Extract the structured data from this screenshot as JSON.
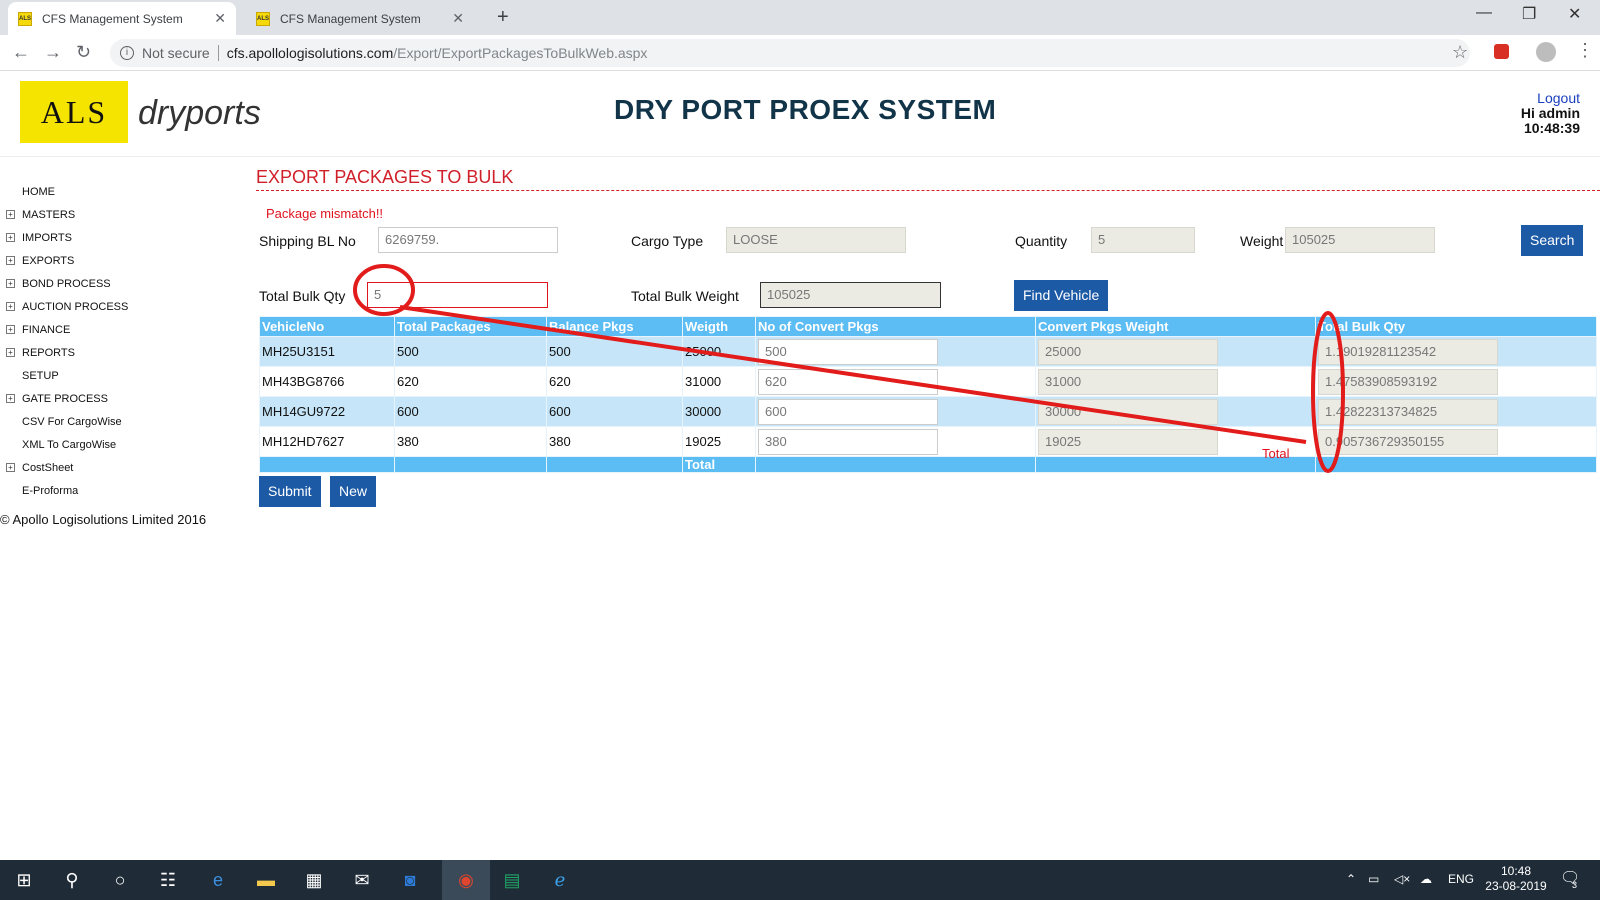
{
  "browser": {
    "tabs": [
      {
        "title": "CFS Management System",
        "favicon": "ALS"
      },
      {
        "title": "CFS Management System",
        "favicon": "ALS"
      }
    ],
    "security": "Not secure",
    "url_host": "cfs.apollologisolutions.com",
    "url_path": "/Export/ExportPackagesToBulkWeb.aspx"
  },
  "header": {
    "logo_letters": "ALS",
    "logo_text": "dryports",
    "site_title": "DRY PORT PROEX SYSTEM",
    "logout": "Logout",
    "greeting": "Hi admin",
    "time": "10:48:39"
  },
  "sidebar": {
    "items": [
      {
        "label": "HOME",
        "expandable": false
      },
      {
        "label": "MASTERS",
        "expandable": true
      },
      {
        "label": "IMPORTS",
        "expandable": true
      },
      {
        "label": "EXPORTS",
        "expandable": true
      },
      {
        "label": "BOND PROCESS",
        "expandable": true
      },
      {
        "label": "AUCTION PROCESS",
        "expandable": true
      },
      {
        "label": "FINANCE",
        "expandable": true
      },
      {
        "label": "REPORTS",
        "expandable": true
      },
      {
        "label": "SETUP",
        "expandable": false
      },
      {
        "label": "GATE PROCESS",
        "expandable": true
      },
      {
        "label": "CSV For CargoWise",
        "expandable": false
      },
      {
        "label": "XML To CargoWise",
        "expandable": false
      },
      {
        "label": "CostSheet",
        "expandable": true
      },
      {
        "label": "E-Proforma",
        "expandable": false
      }
    ],
    "copyright": "© Apollo Logisolutions Limited 2016"
  },
  "main": {
    "page_title": "EXPORT PACKAGES TO BULK",
    "error": "Package mismatch!!",
    "shipping_bl_label": "Shipping BL No",
    "shipping_bl_value": "6269759.",
    "cargo_type_label": "Cargo Type",
    "cargo_type_value": "LOOSE",
    "quantity_label": "Quantity",
    "quantity_value": "5",
    "weight_label": "Weight",
    "weight_value": "105025",
    "search_label": "Search",
    "total_bulk_qty_label": "Total Bulk Qty",
    "total_bulk_qty_value": "5",
    "total_bulk_weight_label": "Total Bulk Weight",
    "total_bulk_weight_value": "105025",
    "find_vehicle_label": "Find Vehicle",
    "submit_label": "Submit",
    "new_label": "New",
    "total_inline": "Total"
  },
  "grid": {
    "columns": [
      "VehicleNo",
      "Total Packages",
      "Balance Pkgs",
      "Weigth",
      "No of Convert Pkgs",
      "Convert Pkgs Weight",
      "Total Bulk Qty"
    ],
    "rows": [
      {
        "vehicle": "MH25U3151",
        "total_pkgs": "500",
        "balance": "500",
        "weight": "25000",
        "convert_pkgs": "500",
        "convert_weight": "25000",
        "bulk_qty": "1.19019281123542"
      },
      {
        "vehicle": "MH43BG8766",
        "total_pkgs": "620",
        "balance": "620",
        "weight": "31000",
        "convert_pkgs": "620",
        "convert_weight": "31000",
        "bulk_qty": "1.47583908593192"
      },
      {
        "vehicle": "MH14GU9722",
        "total_pkgs": "600",
        "balance": "600",
        "weight": "30000",
        "convert_pkgs": "600",
        "convert_weight": "30000",
        "bulk_qty": "1.42822313734825"
      },
      {
        "vehicle": "MH12HD7627",
        "total_pkgs": "380",
        "balance": "380",
        "weight": "19025",
        "convert_pkgs": "380",
        "convert_weight": "19025",
        "bulk_qty": "0.905736729350155"
      }
    ],
    "footer_total": "Total"
  },
  "taskbar": {
    "clock_time": "10:48",
    "clock_date": "23-08-2019",
    "lang": "ENG",
    "notifications": "3"
  },
  "colors": {
    "accent_blue": "#1c5aa6",
    "grid_header": "#5cbcf4",
    "grid_odd_row": "#c6e5f8",
    "error_red": "#e0141e",
    "logo_yellow": "#f5e400"
  }
}
